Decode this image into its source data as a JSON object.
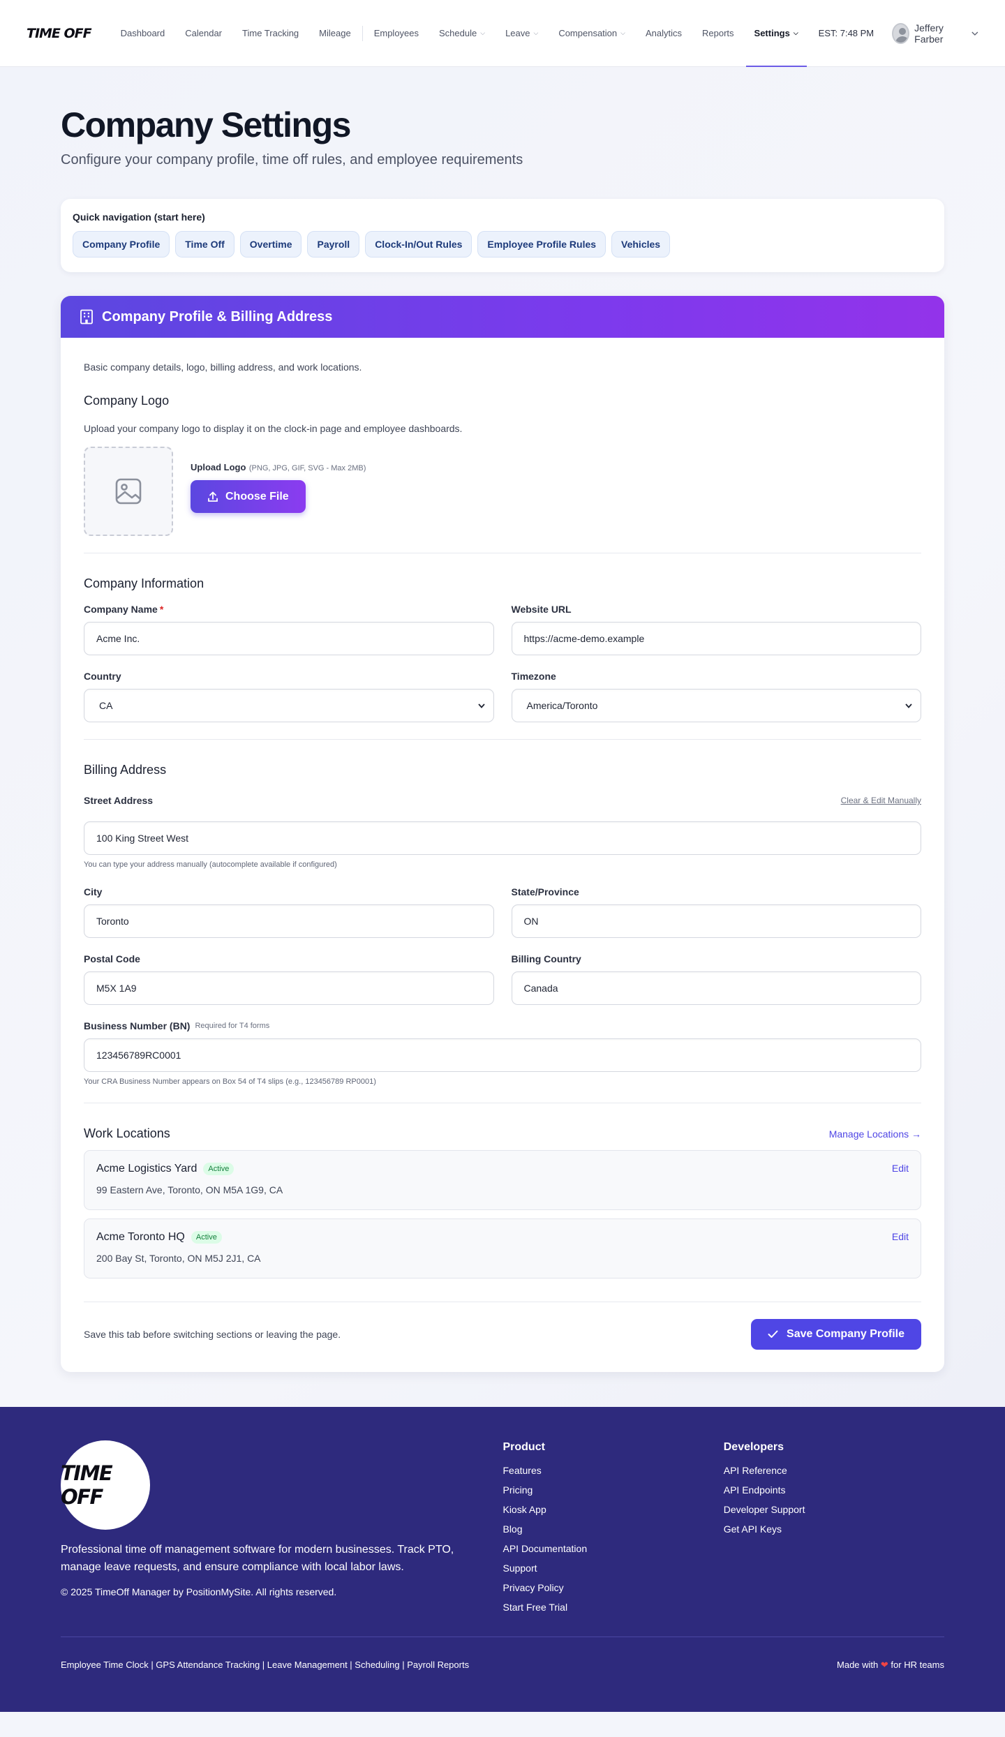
{
  "nav": {
    "logo": "TIME OFF",
    "links": [
      {
        "label": "Dashboard",
        "dropdown": false
      },
      {
        "label": "Calendar",
        "dropdown": false
      },
      {
        "label": "Time Tracking",
        "dropdown": false
      },
      {
        "label": "Mileage",
        "dropdown": false
      },
      {
        "label": "Employees",
        "dropdown": false
      },
      {
        "label": "Schedule",
        "dropdown": true
      },
      {
        "label": "Leave",
        "dropdown": true
      },
      {
        "label": "Compensation",
        "dropdown": true
      },
      {
        "label": "Analytics",
        "dropdown": false
      },
      {
        "label": "Reports",
        "dropdown": false
      },
      {
        "label": "Settings",
        "dropdown": true,
        "active": true
      }
    ],
    "clock": "EST: 7:48 PM",
    "user_name": "Jeffery Farber"
  },
  "header": {
    "title": "Company Settings",
    "subtitle": "Configure your company profile, time off rules, and employee requirements"
  },
  "quicknav": {
    "label": "Quick navigation (start here)",
    "items": [
      "Company Profile",
      "Time Off",
      "Overtime",
      "Payroll",
      "Clock-In/Out Rules",
      "Employee Profile Rules",
      "Vehicles"
    ]
  },
  "profile_card": {
    "title": "Company Profile & Billing Address",
    "description": "Basic company details, logo, billing address, and work locations.",
    "logo": {
      "title": "Company Logo",
      "description": "Upload your company logo to display it on the clock-in page and employee dashboards.",
      "upload_label": "Upload Logo",
      "upload_hint": "(PNG, JPG, GIF, SVG - Max 2MB)",
      "button": "Choose File"
    },
    "company_info": {
      "title": "Company Information",
      "company_name_label": "Company Name",
      "company_name_value": "Acme Inc.",
      "website_label": "Website URL",
      "website_value": "https://acme-demo.example",
      "country_label": "Country",
      "country_value": "CA",
      "timezone_label": "Timezone",
      "timezone_value": "America/Toronto"
    },
    "billing": {
      "title": "Billing Address",
      "street_label": "Street Address",
      "street_action": "Clear & Edit Manually",
      "street_value": "100 King Street West",
      "street_help": "You can type your address manually (autocomplete available if configured)",
      "city_label": "City",
      "city_value": "Toronto",
      "state_label": "State/Province",
      "state_value": "ON",
      "postal_label": "Postal Code",
      "postal_value": "M5X 1A9",
      "billing_country_label": "Billing Country",
      "billing_country_value": "Canada",
      "bn_label": "Business Number (BN)",
      "bn_note": "Required for T4 forms",
      "bn_value": "123456789RC0001",
      "bn_help": "Your CRA Business Number appears on Box 54 of T4 slips (e.g., 123456789 RP0001)"
    },
    "locations": {
      "title": "Work Locations",
      "manage_link": "Manage Locations →",
      "items": [
        {
          "name": "Acme Logistics Yard",
          "status": "Active",
          "address": "99 Eastern Ave, Toronto, ON M5A 1G9, CA",
          "edit": "Edit"
        },
        {
          "name": "Acme Toronto HQ",
          "status": "Active",
          "address": "200 Bay St, Toronto, ON M5J 2J1, CA",
          "edit": "Edit"
        }
      ]
    },
    "save": {
      "note": "Save this tab before switching sections or leaving the page.",
      "button": "Save Company Profile"
    }
  },
  "footer": {
    "logo": "TIME OFF",
    "description": "Professional time off management software for modern businesses. Track PTO, manage leave requests, and ensure compliance with local labor laws.",
    "copyright": "© 2025 TimeOff Manager by PositionMySite. All rights reserved.",
    "product_title": "Product",
    "product_links": [
      "Features",
      "Pricing",
      "Kiosk App",
      "Blog",
      "API Documentation",
      "Support",
      "Privacy Policy",
      "Start Free Trial"
    ],
    "developers_title": "Developers",
    "developer_links": [
      "API Reference",
      "API Endpoints",
      "Developer Support",
      "Get API Keys"
    ],
    "bottom_left": "Employee Time Clock | GPS Attendance Tracking | Leave Management | Scheduling | Payroll Reports",
    "made_with_prefix": "Made with",
    "made_with_suffix": "for HR teams"
  },
  "colors": {
    "accent": "#4f46e5",
    "header_gradient_start": "#5b47e0",
    "header_gradient_end": "#9333ea",
    "footer_bg": "#2e2a7d",
    "status_active": "#15803d"
  }
}
